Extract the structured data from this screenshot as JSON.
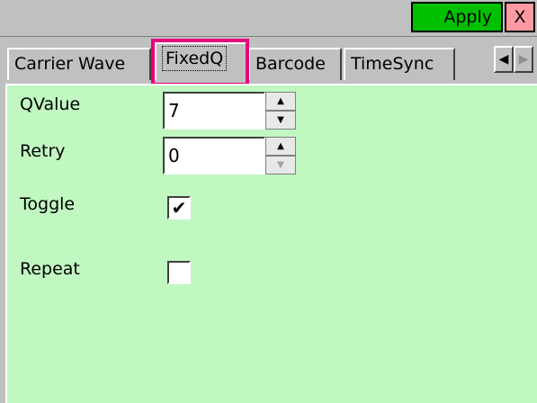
{
  "toolbar": {
    "apply_label": "Apply",
    "close_label": "X"
  },
  "tabs": [
    {
      "label": "Carrier Wave"
    },
    {
      "label": "FixedQ"
    },
    {
      "label": "Barcode"
    },
    {
      "label": "TimeSync"
    }
  ],
  "fixedq": {
    "qvalue_label": "QValue",
    "qvalue_value": "7",
    "retry_label": "Retry",
    "retry_value": "0",
    "toggle_label": "Toggle",
    "toggle_checked": true,
    "repeat_label": "Repeat",
    "repeat_checked": false
  },
  "glyphs": {
    "check": "✔",
    "up": "▲",
    "down": "▼",
    "left": "◀",
    "right": "▶"
  },
  "colors": {
    "panel": "#c1f7c1",
    "apply": "#00c000",
    "close": "#ff9aa2",
    "highlight": "#e6007e"
  }
}
